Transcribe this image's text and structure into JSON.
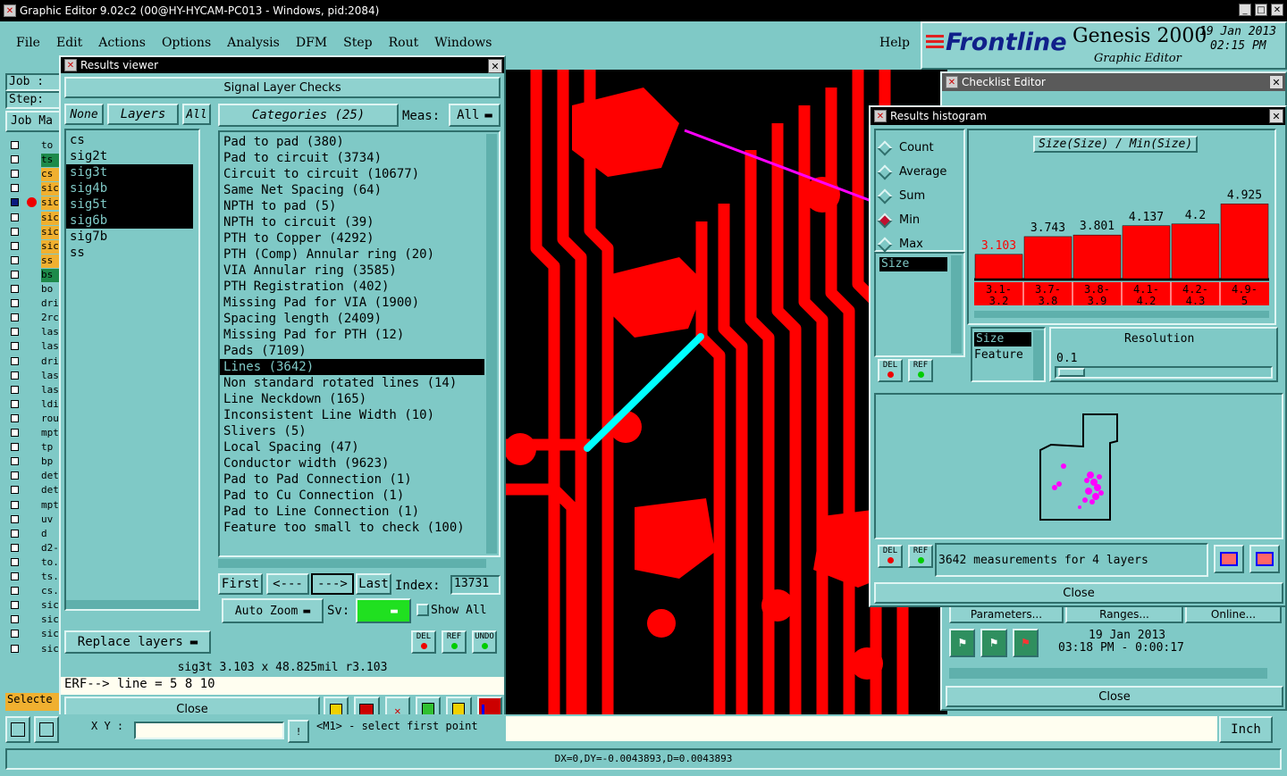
{
  "app": {
    "title": "Graphic Editor 9.02c2 (00@HY-HYCAM-PC013 - Windows, pid:2084)",
    "menu": [
      "File",
      "Edit",
      "Actions",
      "Options",
      "Analysis",
      "DFM",
      "Step",
      "Rout",
      "Windows"
    ],
    "help": "Help",
    "brand": "Frontline",
    "product": "Genesis 2000",
    "subtitle": "Graphic Editor",
    "date": "19 Jan 2013",
    "time": "02:15 PM",
    "job_label": "Job :",
    "step_label": "Step:",
    "job_matrix": "Job Ma",
    "selected": "Selecte",
    "xy_label": "X Y :",
    "prompt": "<M1> - select first point",
    "units": "Inch",
    "status": "DX=0,DY=-0.0043893,D=0.0043893",
    "layer_names": [
      "to",
      "ts",
      "cs",
      "sic",
      "sic",
      "sic",
      "sic",
      "sic",
      "ss",
      "bs",
      "bo",
      "dri",
      "2rc",
      "las",
      "las",
      "dri",
      "las",
      "las",
      "ldi",
      "rou",
      "mpt",
      "tp",
      "bp",
      "det",
      "det",
      "mpt",
      "uv",
      "d",
      "d2-",
      "to.",
      "ts.",
      "cs.",
      "sic",
      "sic",
      "sic",
      "sic"
    ]
  },
  "results_viewer": {
    "title": "Results viewer",
    "header": "Signal Layer Checks",
    "none": "None",
    "layers": "Layers",
    "all": "All",
    "categories": "Categories (25)",
    "meas_label": "Meas:",
    "meas_value": "All",
    "layer_list": [
      "cs",
      "sig2t",
      "sig3t",
      "sig4b",
      "sig5t",
      "sig6b",
      "sig7b",
      "ss"
    ],
    "category_list": [
      "Pad to pad (380)",
      "Pad to circuit (3734)",
      "Circuit to circuit (10677)",
      "Same Net Spacing (64)",
      "NPTH to pad (5)",
      "NPTH to circuit (39)",
      "PTH to Copper (4292)",
      "PTH (Comp) Annular ring (20)",
      "VIA Annular ring (3585)",
      "PTH Registration (402)",
      "Missing Pad for VIA (1900)",
      "Spacing length (2409)",
      "Missing Pad for PTH (12)",
      "Pads (7109)",
      "Lines (3642)",
      "Non standard rotated lines (14)",
      "Line Neckdown (165)",
      "Inconsistent Line Width (10)",
      "Slivers (5)",
      "Local Spacing (47)",
      "Conductor width (9623)",
      "Pad to Pad Connection (1)",
      "Pad to Cu Connection (1)",
      "Pad to Line Connection (1)",
      "Feature too small to check (100)"
    ],
    "first": "First",
    "prev": "<---",
    "next": "--->",
    "last": "Last",
    "index_label": "Index:",
    "index_value": "13731",
    "auto_zoom": "Auto Zoom",
    "sv": "Sv:",
    "show_all": "Show All",
    "replace_layers": "Replace layers",
    "del": "DEL",
    "ref": "REF",
    "undo": "UNDO",
    "info": "sig3t 3.103 x 48.825mil  r3.103",
    "erf": "ERF--> line = 5 8 10",
    "close": "Close"
  },
  "checklist_editor": {
    "title": "Checklist Editor",
    "parameters": "Parameters...",
    "ranges": "Ranges...",
    "online": "Online...",
    "run_date": "19 Jan 2013",
    "run_time": "03:18 PM - 0:00:17",
    "close": "Close"
  },
  "histogram": {
    "title": "Results histogram",
    "options": [
      "Count",
      "Average",
      "Sum",
      "Min",
      "Max"
    ],
    "selected_option": "Min",
    "chart_title": "Size(Size) / Min(Size)",
    "attr_list": [
      "Size"
    ],
    "x_list": [
      "Size",
      "Feature"
    ],
    "resolution_label": "Resolution",
    "resolution_value": "0.1",
    "del": "DEL",
    "ref": "REF",
    "measurements": "3642 measurements for 4 layers",
    "close": "Close"
  },
  "chart_data": {
    "type": "bar",
    "title": "Size(Size) / Min(Size)",
    "categories": [
      "3.1-3.2",
      "3.7-3.8",
      "3.8-3.9",
      "4.1-4.2",
      "4.2-4.3",
      "4.9-5"
    ],
    "values": [
      3.103,
      3.743,
      3.801,
      4.137,
      4.2,
      4.925
    ],
    "value_labels": [
      "3.103",
      "3.743",
      "3.801",
      "4.137",
      "4.2",
      "4.925"
    ],
    "category_labels": [
      [
        "3.1-",
        "3.2"
      ],
      [
        "3.7-",
        "3.8"
      ],
      [
        "3.8-",
        "3.9"
      ],
      [
        "4.1-",
        "4.2"
      ],
      [
        "4.2-",
        "4.3"
      ],
      [
        "4.9-",
        "5"
      ]
    ],
    "ylim": [
      3.0,
      5.0
    ],
    "colors": {
      "bar": "#ff0000",
      "highlight_label": "#ff0000"
    }
  },
  "colors": {
    "window_bg": "#7fc9c6",
    "canvas_bg": "#000000",
    "copper": "#ff0000",
    "selected_line": "#00ffff",
    "annotation_arrow": "#ff00ff"
  }
}
